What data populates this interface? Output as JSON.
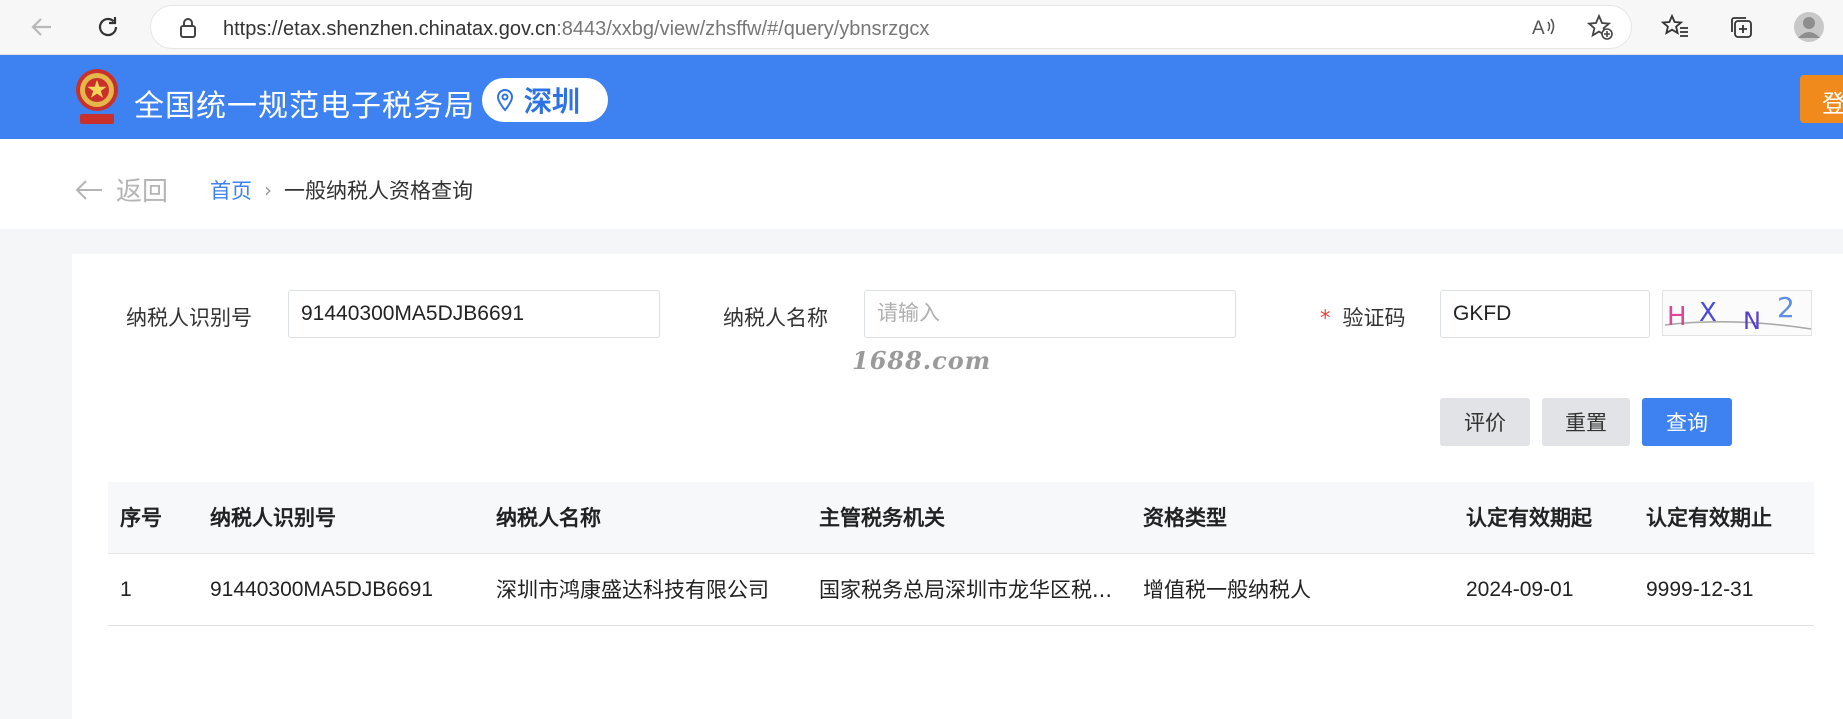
{
  "browser": {
    "url_host": "https://etax.shenzhen.chinatax.gov.cn",
    "url_rest": ":8443/xxbg/view/zhsffw/#/query/ybnsrzgcx"
  },
  "header": {
    "site_title": "全国统一规范电子税务局",
    "city": "深圳",
    "login_label": "登"
  },
  "breadcrumb": {
    "back_label": "返回",
    "home": "首页",
    "separator": "›",
    "current": "一般纳税人资格查询"
  },
  "form": {
    "taxpayer_id_label": "纳税人识别号",
    "taxpayer_id_value": "91440300MA5DJB6691",
    "taxpayer_name_label": "纳税人名称",
    "taxpayer_name_placeholder": "请输入",
    "captcha_required_mark": "*",
    "captcha_label": "验证码",
    "captcha_value": "GKFD",
    "captcha_image_text": "HXN2"
  },
  "watermark": "1688.com",
  "buttons": {
    "evaluate": "评价",
    "reset": "重置",
    "query": "查询"
  },
  "table": {
    "headers": [
      "序号",
      "纳税人识别号",
      "纳税人名称",
      "主管税务机关",
      "资格类型",
      "认定有效期起",
      "认定有效期止"
    ],
    "rows": [
      [
        "1",
        "91440300MA5DJB6691",
        "深圳市鸿康盛达科技有限公司",
        "国家税务总局深圳市龙华区税...",
        "增值税一般纳税人",
        "2024-09-01",
        "9999-12-31"
      ]
    ]
  },
  "colors": {
    "header_blue": "#3d82f0",
    "login_orange": "#f08a1d",
    "required_red": "#e8413b"
  }
}
